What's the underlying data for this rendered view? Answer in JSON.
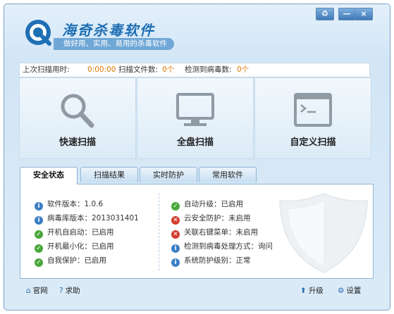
{
  "window_buttons": {
    "skin": "♻",
    "minimize": "—",
    "close": "×"
  },
  "app": {
    "title": "海奇杀毒软件",
    "slogan": "做好用、实用、易用的杀毒软件"
  },
  "stats": {
    "last_scan_label": "上次扫描用时:",
    "last_scan_value": "0:00:00",
    "files_label": "扫描文件数:",
    "files_value": "0个",
    "virus_label": "检测到病毒数:",
    "virus_value": "0个"
  },
  "scan": {
    "quick": "快速扫描",
    "full": "全盘扫描",
    "custom": "自定义扫描"
  },
  "tabs": [
    {
      "label": "安全状态"
    },
    {
      "label": "扫描结果"
    },
    {
      "label": "实时防护"
    },
    {
      "label": "常用软件"
    }
  ],
  "status_left": [
    {
      "icon": "info-icon",
      "text": "软件版本：1.0.6"
    },
    {
      "icon": "info-icon",
      "text": "病毒库版本：2013031401"
    },
    {
      "icon": "check-icon",
      "text": "开机自启动：已启用"
    },
    {
      "icon": "check-icon",
      "text": "开机最小化：已启用"
    },
    {
      "icon": "check-icon",
      "text": "自我保护：已启用"
    }
  ],
  "status_right": [
    {
      "icon": "check-icon",
      "text": "自动升级：已启用"
    },
    {
      "icon": "cross-icon",
      "text": "云安全防护：未启用"
    },
    {
      "icon": "cross-icon",
      "text": "关联右键菜单：未启用"
    },
    {
      "icon": "info-icon",
      "text": "检测到病毒处理方式：询问"
    },
    {
      "icon": "info-icon",
      "text": "系统防护级别：正常"
    }
  ],
  "bottom": {
    "home": "官网",
    "help": "求助",
    "upgrade": "升级",
    "settings": "设置"
  },
  "colors": {
    "accent": "#1f6fb4",
    "value": "#e07a00",
    "ok": "#49a83a",
    "error": "#d23b2c",
    "info": "#3c7fc4"
  }
}
